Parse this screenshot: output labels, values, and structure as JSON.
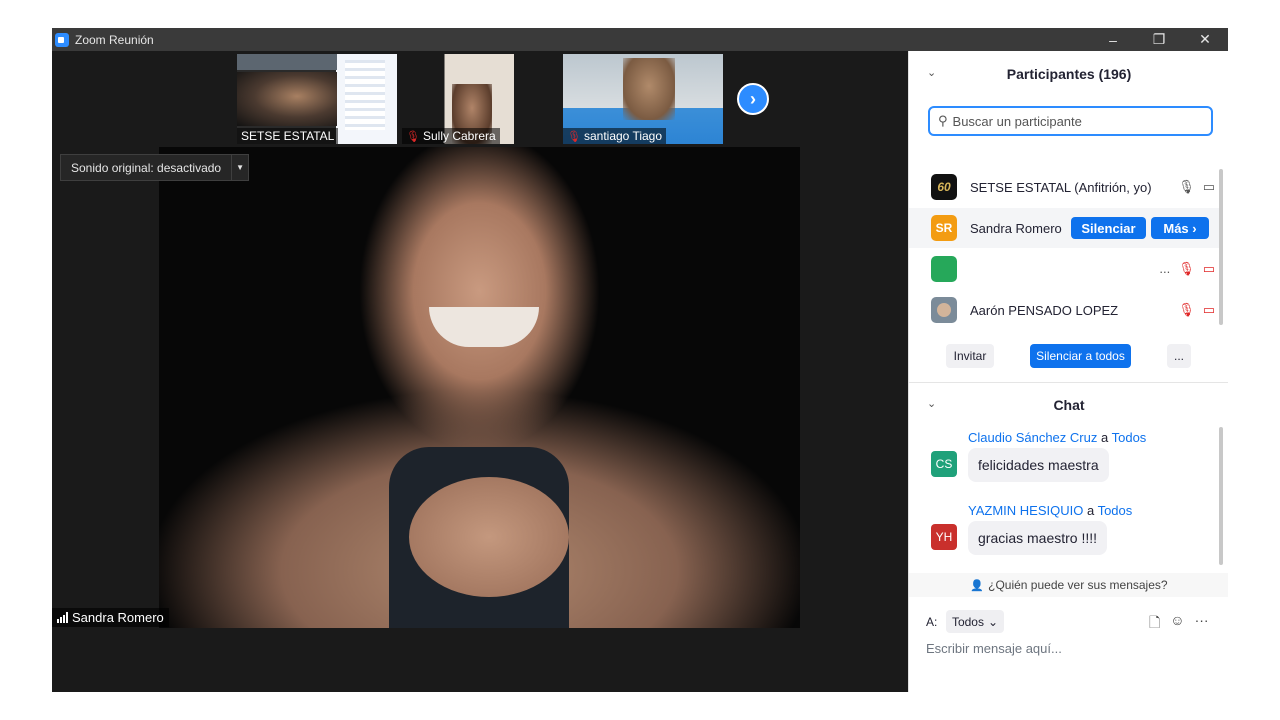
{
  "window": {
    "title": "Zoom Reunión",
    "minimize_label": "–",
    "restore_label": "❐",
    "close_label": "✕"
  },
  "thumbnails": [
    {
      "name": "SETSE ESTATAL",
      "muted": false
    },
    {
      "name": "Sully Cabrera",
      "muted": true
    },
    {
      "name": "santiago Tiago",
      "muted": true
    }
  ],
  "thumb_icons": {
    "mic_off": "🎙"
  },
  "next_page_label": "›",
  "sound_original": {
    "label": "Sonido original: desactivado",
    "caret": "▼"
  },
  "active_speaker": {
    "name": "Sandra Romero"
  },
  "participants": {
    "header": "Participantes (196)",
    "collapse_icon": "⌄",
    "search_placeholder": "Buscar un participante",
    "search_icon_glyph": "⚲",
    "list": [
      {
        "name": "SETSE ESTATAL (Anfitrión, yo)",
        "avatar_text": "60",
        "avatar_color": "#111111"
      },
      {
        "name": "Sandra Romero",
        "avatar_text": "SR",
        "avatar_color": "#f39c12"
      },
      {
        "name": "",
        "avatar_text": "",
        "avatar_color": "#26a85a",
        "ellipsis": "..."
      },
      {
        "name": "Aarón PENSADO LOPEZ",
        "avatar_text": "",
        "avatar_color": "#7b8b99"
      }
    ],
    "mute_button": "Silenciar",
    "more_button": "Más ›",
    "invite_button": "Invitar",
    "mute_all_button": "Silenciar a todos",
    "more_options_button": "...",
    "icons": {
      "mic": "🎙",
      "camera": "▭",
      "mic_off": "🎙",
      "camera_off": "▭"
    }
  },
  "chat": {
    "header": "Chat",
    "collapse_icon": "⌄",
    "messages": [
      {
        "sender": "Claudio Sánchez Cruz",
        "to_word": "a",
        "recipient": "Todos",
        "initials": "CS",
        "avatar_color": "#1fa17a",
        "text": "felicidades maestra"
      },
      {
        "sender": "YAZMIN HESIQUIO",
        "to_word": "a",
        "recipient": "Todos",
        "initials": "YH",
        "avatar_color": "#c9302c",
        "text": "gracias maestro !!!!"
      }
    ],
    "who_can_see": "¿Quién puede ver sus mensajes?",
    "who_icon": "👤",
    "to_label": "A:",
    "to_value": "Todos",
    "to_caret": "⌄",
    "file_icon": "🗋",
    "emoji_icon": "☺",
    "more_icon": "···",
    "input_placeholder": "Escribir mensaje aquí..."
  }
}
